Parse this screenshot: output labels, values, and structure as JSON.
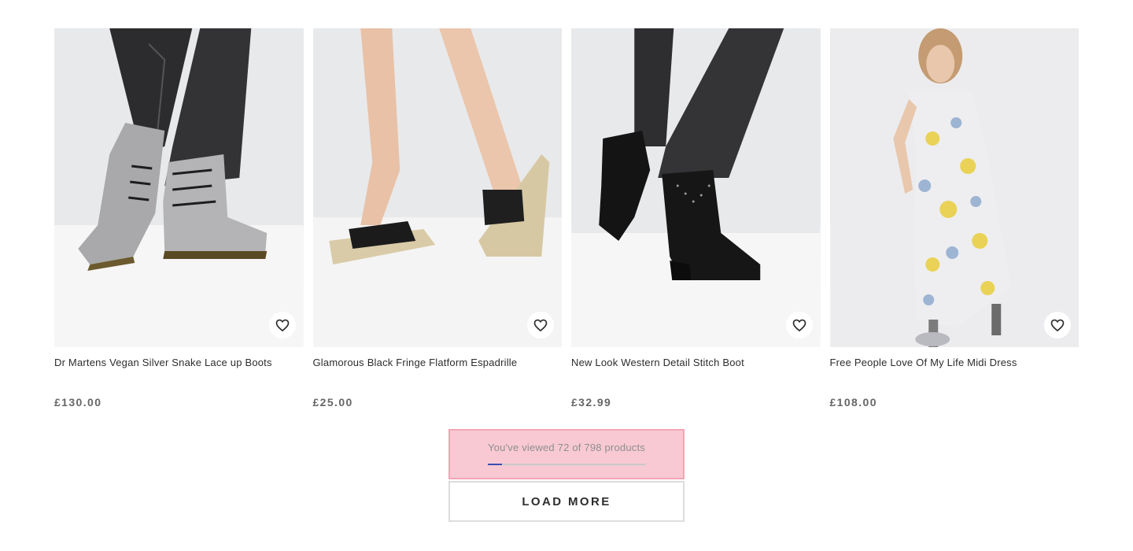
{
  "products": [
    {
      "title": "Dr Martens Vegan Silver Snake Lace up Boots",
      "price": "£130.00",
      "image": "silver-snake-boots-image",
      "wishlist_icon": "heart-icon"
    },
    {
      "title": "Glamorous Black Fringe Flatform Espadrille",
      "price": "£25.00",
      "image": "black-fringe-espadrille-image",
      "wishlist_icon": "heart-icon"
    },
    {
      "title": "New Look Western Detail Stitch Boot",
      "price": "£32.99",
      "image": "western-stitch-boot-image",
      "wishlist_icon": "heart-icon"
    },
    {
      "title": "Free People Love Of My Life Midi Dress",
      "price": "£108.00",
      "image": "floral-midi-dress-image",
      "wishlist_icon": "heart-icon"
    }
  ],
  "pagination": {
    "progress_text": "You've viewed 72 of 798 products",
    "viewed": 72,
    "total": 798,
    "progress_fraction": 0.09,
    "load_more_label": "LOAD MORE"
  },
  "colors": {
    "progress_highlight": "#f8c9d3",
    "progress_fill": "#3d4db0",
    "price_text": "#666666"
  }
}
